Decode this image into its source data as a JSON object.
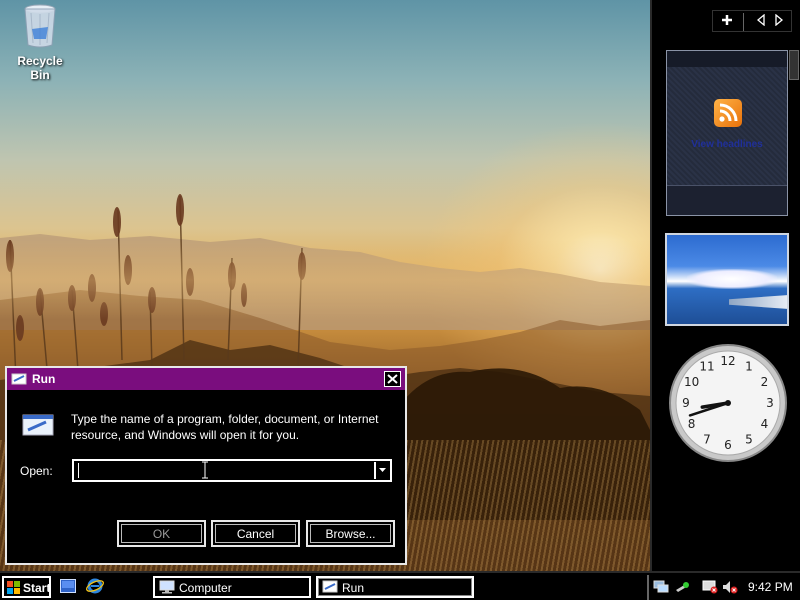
{
  "desktop": {
    "icons": [
      {
        "label": "Recycle Bin",
        "icon": "recycle-bin-icon"
      }
    ]
  },
  "run_dialog": {
    "title": "Run",
    "instructions": "Type the name of a program, folder, document, or Internet resource, and Windows will open it for you.",
    "open_label": "Open:",
    "open_value": "",
    "buttons": {
      "ok": "OK",
      "cancel": "Cancel",
      "browse": "Browse..."
    }
  },
  "sidebar": {
    "toolbar_icons": [
      "add-gadget-icon",
      "prev-icon",
      "next-icon"
    ],
    "feed_gadget": {
      "link_text": "View headlines"
    },
    "clock": {
      "hour": 8,
      "minute": 42
    }
  },
  "taskbar": {
    "start_label": "Start",
    "quick_launch": [
      "show-desktop-icon",
      "internet-explorer-icon"
    ],
    "tasks": [
      {
        "label": "Computer",
        "icon": "computer-icon",
        "active": false
      },
      {
        "label": "Run",
        "icon": "run-icon",
        "active": true
      }
    ],
    "tray_icons": [
      "network-icon",
      "safely-remove-icon",
      "network-disconnected-icon",
      "volume-muted-icon"
    ],
    "time": "9:42 PM"
  },
  "colors": {
    "title_bar": "#7a0d7e",
    "high_contrast_bg": "#000000",
    "high_contrast_fg": "#ffffff",
    "disabled_text": "#9a9a9a"
  }
}
